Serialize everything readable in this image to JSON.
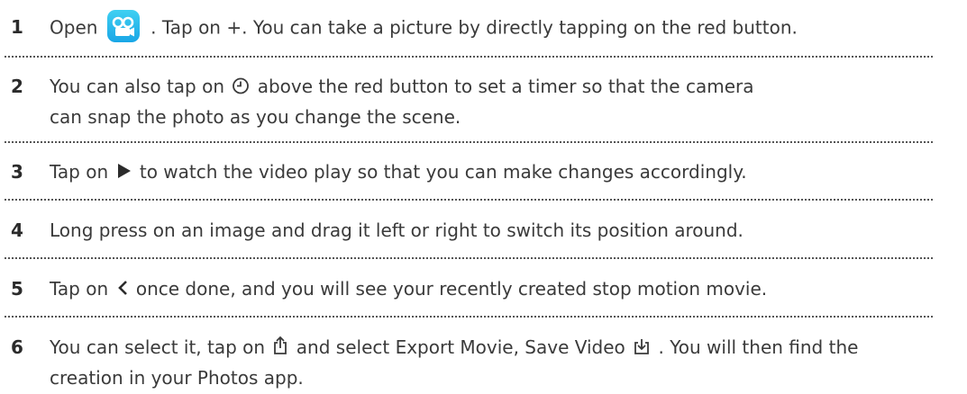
{
  "steps": [
    {
      "number": "1",
      "parts": [
        "Open",
        ". Tap on +. You can take a picture by directly tapping on the red button."
      ]
    },
    {
      "number": "2",
      "parts": [
        "You can also tap on",
        "above the red button to set a timer so that the camera can snap the photo as you change the scene."
      ]
    },
    {
      "number": "3",
      "parts": [
        "Tap on",
        "to watch the video play so that you can make changes accordingly."
      ]
    },
    {
      "number": "4",
      "parts": [
        "Long press on an image and drag it left or right to switch its position around."
      ]
    },
    {
      "number": "5",
      "parts": [
        "Tap on",
        "once done, and you will see your recently created stop motion movie."
      ]
    },
    {
      "number": "6",
      "parts": [
        "You can select it, tap on",
        "and select Export Movie, Save Video",
        ". You will then find the creation in your Photos app."
      ]
    }
  ],
  "icons": {
    "app": "stop-motion-app-icon",
    "timer": "timer-icon",
    "play": "play-icon",
    "back": "chevron-left-icon",
    "share": "share-icon",
    "save": "save-video-icon"
  },
  "colors": {
    "app_icon": "#29b6ea",
    "text": "#3a3a3a",
    "divider": "#555555"
  }
}
